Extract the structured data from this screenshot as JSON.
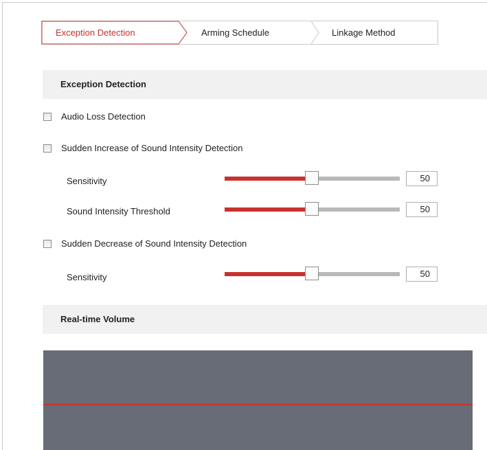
{
  "tabs": [
    {
      "label": "Exception Detection",
      "active": true
    },
    {
      "label": "Arming Schedule",
      "active": false
    },
    {
      "label": "Linkage Method",
      "active": false
    }
  ],
  "exception_section": {
    "title": "Exception Detection"
  },
  "audio_loss": {
    "label": "Audio Loss Detection",
    "checked": false
  },
  "sudden_increase": {
    "label": "Sudden Increase of Sound Intensity Detection",
    "checked": false,
    "sensitivity": {
      "label": "Sensitivity",
      "value": "50"
    },
    "threshold": {
      "label": "Sound Intensity Threshold",
      "value": "50"
    }
  },
  "sudden_decrease": {
    "label": "Sudden Decrease of Sound Intensity Detection",
    "checked": false,
    "sensitivity": {
      "label": "Sensitivity",
      "value": "50"
    }
  },
  "realtime_section": {
    "title": "Real-time Volume"
  },
  "colors": {
    "accent": "#c8322e",
    "track": "#b9b9b9",
    "section_bg": "#f1f1f1",
    "volume_bg": "#686c76"
  }
}
